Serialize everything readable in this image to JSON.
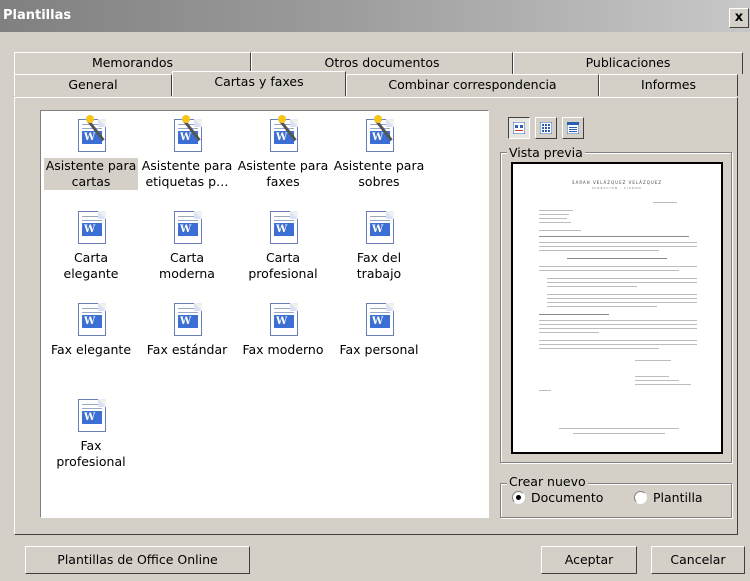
{
  "window": {
    "title": "Plantillas",
    "close_label": "x"
  },
  "tabs_back": [
    {
      "label": "Memorandos"
    },
    {
      "label": "Otros documentos"
    },
    {
      "label": "Publicaciones"
    }
  ],
  "tabs_front": [
    {
      "label": "General"
    },
    {
      "label": "Cartas y faxes",
      "active": true
    },
    {
      "label": "Combinar correspondencia"
    },
    {
      "label": "Informes"
    }
  ],
  "templates": [
    {
      "line1": "Asistente para",
      "line2": "cartas",
      "type": "wizard",
      "selected": true
    },
    {
      "line1": "Asistente para",
      "line2": "etiquetas p…",
      "type": "wizard"
    },
    {
      "line1": "Asistente para",
      "line2": "faxes",
      "type": "wizard"
    },
    {
      "line1": "Asistente para",
      "line2": "sobres",
      "type": "wizard"
    },
    {
      "line1": "Carta",
      "line2": "elegante",
      "type": "document"
    },
    {
      "line1": "Carta",
      "line2": "moderna",
      "type": "document"
    },
    {
      "line1": "Carta",
      "line2": "profesional",
      "type": "document"
    },
    {
      "line1": "Fax del",
      "line2": "trabajo",
      "type": "document"
    },
    {
      "line1": "Fax elegante",
      "line2": "",
      "type": "document"
    },
    {
      "line1": "Fax estándar",
      "line2": "",
      "type": "document"
    },
    {
      "line1": "Fax moderno",
      "line2": "",
      "type": "document"
    },
    {
      "line1": "Fax personal",
      "line2": "",
      "type": "document"
    },
    {
      "line1": "Fax",
      "line2": "profesional",
      "type": "document"
    }
  ],
  "view_buttons": [
    {
      "icon": "large-icons-view-icon",
      "pressed": true
    },
    {
      "icon": "list-view-icon",
      "pressed": false
    },
    {
      "icon": "details-view-icon",
      "pressed": false
    }
  ],
  "preview": {
    "legend": "Vista previa",
    "header_line1": "SARAH VELÁZQUEZ VELÁZQUEZ",
    "header_line2": "DIRECCIÓN · CIUDAD"
  },
  "create_new": {
    "legend": "Crear nuevo",
    "options": [
      {
        "label": "Documento",
        "selected": true
      },
      {
        "label": "Plantilla",
        "selected": false
      }
    ]
  },
  "buttons": {
    "office_online": "Plantillas de Office Online",
    "accept": "Aceptar",
    "cancel": "Cancelar"
  },
  "colors": {
    "titlebar": "#808080",
    "dialog_bg": "#d4d0c8",
    "word_blue": "#3b6fd4"
  }
}
